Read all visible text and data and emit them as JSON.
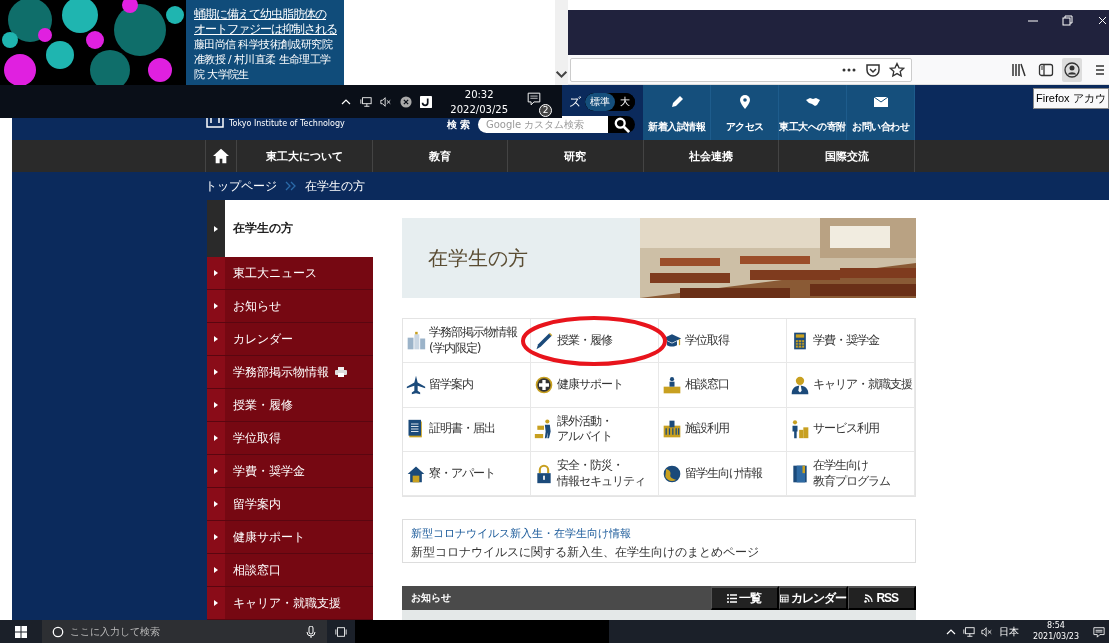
{
  "overlay_window": {
    "article_link_lines": [
      "蛹期に備えて幼虫脂肪体の",
      "オートファジーは抑制される"
    ],
    "article_author_lines": [
      "藤田尚信 科学技術創成研究院",
      "准教授 / 村川直柔 生命理工学",
      "院 大学院生"
    ]
  },
  "overlay_taskbar": {
    "time": "20:32",
    "date": "2022/03/25",
    "notification_count": "2"
  },
  "browser": {
    "tooltip": "Firefox アカウ"
  },
  "site": {
    "logo_text": "Tokyo Institute of Technology",
    "font_size": {
      "label": "ズ",
      "options": [
        {
          "label": "標準",
          "selected": true
        },
        {
          "label": "大",
          "selected": false
        }
      ]
    },
    "search": {
      "label": "検 索",
      "placeholder": "Google カスタム検索"
    },
    "quick_links": [
      "新着入試情報",
      "アクセス",
      "東工大への寄附",
      "お問い合わせ"
    ],
    "nav": [
      "東工大について",
      "教育",
      "研究",
      "社会連携",
      "国際交流"
    ],
    "breadcrumb": [
      "トップページ",
      "在学生の方"
    ],
    "sidebar": {
      "title": "在学生の方",
      "items": [
        {
          "label": "東工大ニュース",
          "restricted": false
        },
        {
          "label": "お知らせ",
          "restricted": false
        },
        {
          "label": "カレンダー",
          "restricted": false
        },
        {
          "label": "学務部掲示物情報",
          "restricted": true
        },
        {
          "label": "授業・履修",
          "restricted": false
        },
        {
          "label": "学位取得",
          "restricted": false
        },
        {
          "label": "学費・奨学金",
          "restricted": false
        },
        {
          "label": "留学案内",
          "restricted": false
        },
        {
          "label": "健康サポート",
          "restricted": false
        },
        {
          "label": "相談窓口",
          "restricted": false
        },
        {
          "label": "キャリア・就職支援",
          "restricted": false
        }
      ]
    },
    "banner": {
      "title": "在学生の方"
    },
    "tiles": [
      {
        "lines": [
          "学務部掲示物情報",
          "(学内限定)"
        ],
        "circled": false
      },
      {
        "lines": [
          "授業・履修"
        ],
        "circled": true
      },
      {
        "lines": [
          "学位取得"
        ],
        "circled": false
      },
      {
        "lines": [
          "学費・奨学金"
        ],
        "circled": false
      },
      {
        "lines": [
          "留学案内"
        ],
        "circled": false
      },
      {
        "lines": [
          "健康サポート"
        ],
        "circled": false
      },
      {
        "lines": [
          "相談窓口"
        ],
        "circled": false
      },
      {
        "lines": [
          "キャリア・就職支援"
        ],
        "circled": false
      },
      {
        "lines": [
          "証明書・届出"
        ],
        "circled": false
      },
      {
        "lines": [
          "課外活動・",
          "アルバイト"
        ],
        "circled": false
      },
      {
        "lines": [
          "施設利用"
        ],
        "circled": false
      },
      {
        "lines": [
          "サービス利用"
        ],
        "circled": false
      },
      {
        "lines": [
          "寮・アパート"
        ],
        "circled": false
      },
      {
        "lines": [
          "安全・防災・",
          "情報セキュリティ"
        ],
        "circled": false
      },
      {
        "lines": [
          "留学生向け情報"
        ],
        "circled": false
      },
      {
        "lines": [
          "在学生向け",
          "教育プログラム"
        ],
        "circled": false
      }
    ],
    "notice": {
      "title": "新型コロナウイルス新入生・在学生向け情報",
      "description": "新型コロナウイルスに関する新入生、在学生向けのまとめページ"
    },
    "news": {
      "title": "お知らせ",
      "buttons": [
        "一覧",
        "カレンダー",
        "RSS"
      ]
    }
  },
  "taskbar": {
    "search_placeholder": "ここに入力して検索",
    "language": "日本",
    "time": "8:54",
    "date": "2021/03/23"
  }
}
